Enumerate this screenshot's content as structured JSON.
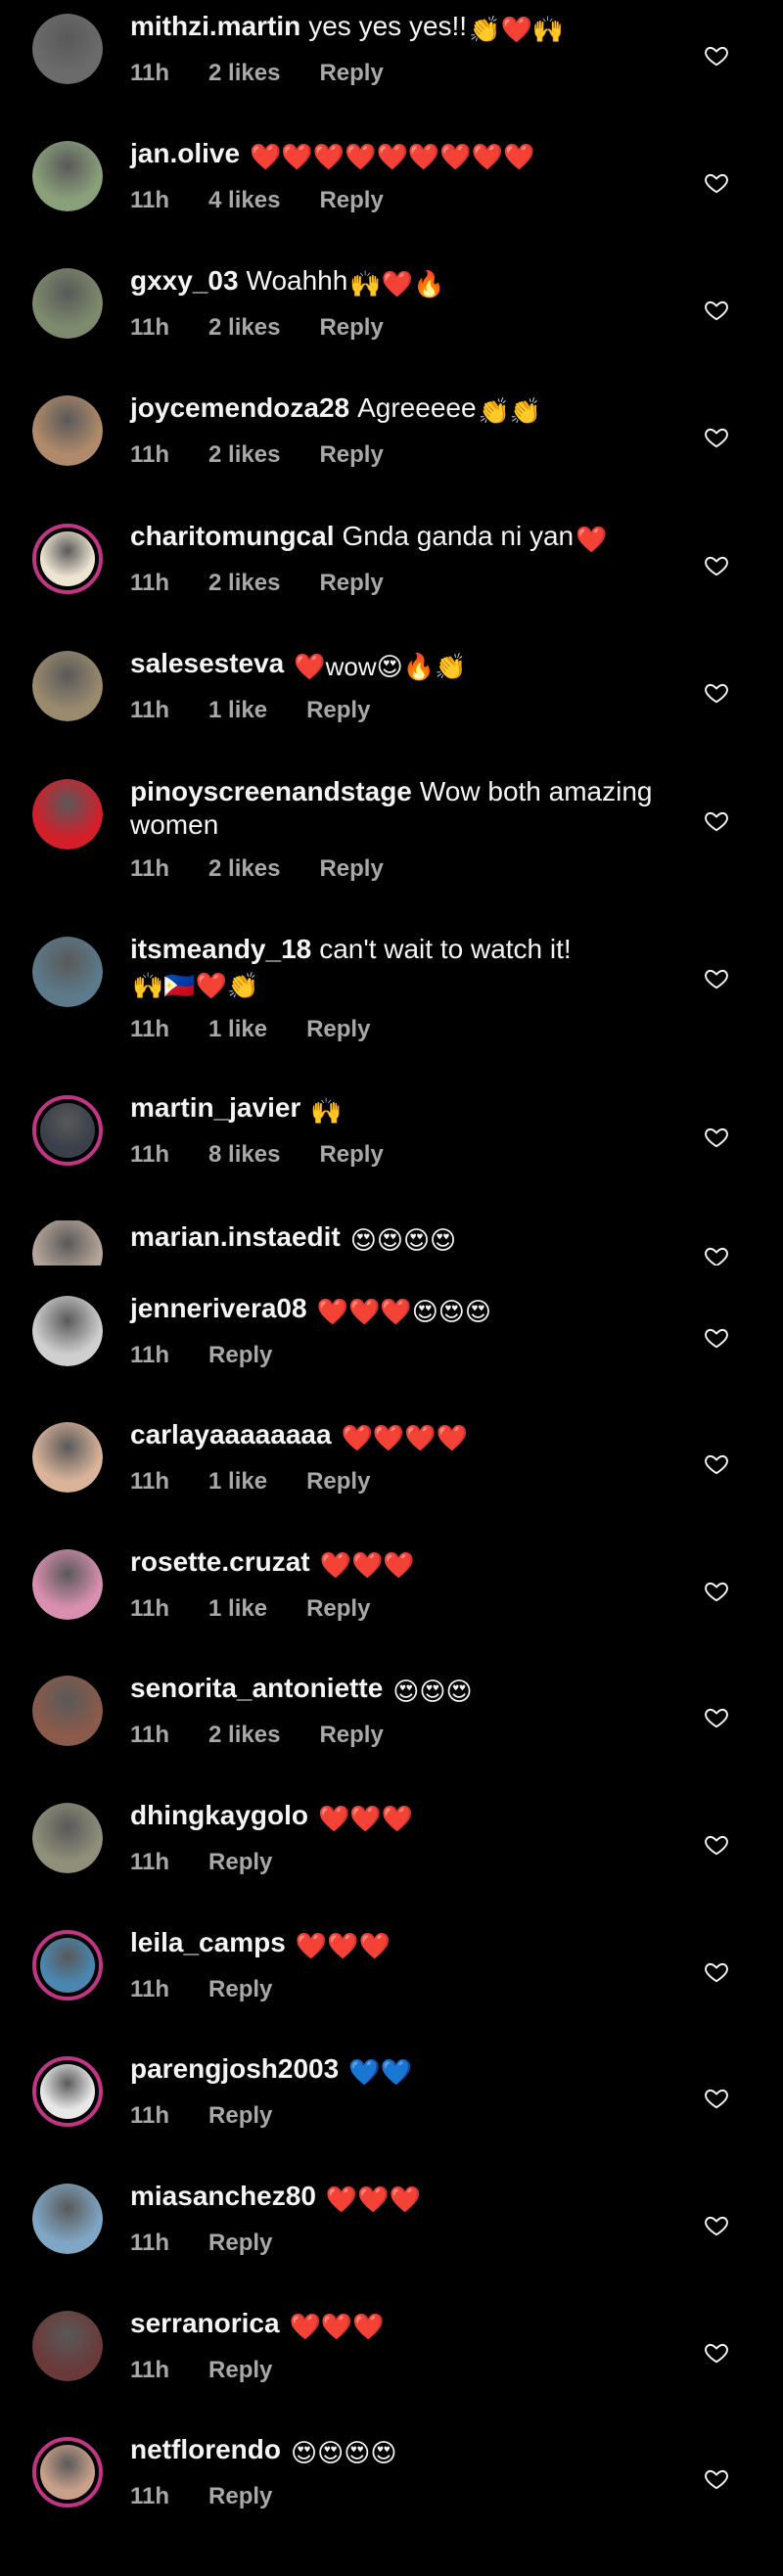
{
  "icons": {
    "like": "heart-outline-icon"
  },
  "comments": [
    {
      "user": "mithzi.martin",
      "text": "yes yes yes!!",
      "emoji": "👏❤️🙌",
      "time": "11h",
      "likes": "2 likes",
      "reply": "Reply",
      "ring": false,
      "color": "#6b6b6b"
    },
    {
      "user": "jan.olive",
      "text": "",
      "emoji": "❤️❤️❤️❤️❤️❤️❤️❤️❤️",
      "time": "11h",
      "likes": "4 likes",
      "reply": "Reply",
      "ring": false,
      "color": "#8aa07a"
    },
    {
      "user": "gxxy_03",
      "text": "Woahhh",
      "emoji": "🙌❤️🔥",
      "time": "11h",
      "likes": "2 likes",
      "reply": "Reply",
      "ring": false,
      "color": "#7d8a6c"
    },
    {
      "user": "joycemendoza28",
      "text": "Agreeeee",
      "emoji": "👏👏",
      "time": "11h",
      "likes": "2 likes",
      "reply": "Reply",
      "ring": false,
      "color": "#b08a6a"
    },
    {
      "user": "charitomungcal",
      "text": "Gnda ganda ni yan",
      "emoji": "❤️",
      "time": "11h",
      "likes": "2 likes",
      "reply": "Reply",
      "ring": true,
      "color": "#ede4d2"
    },
    {
      "user": "salesesteva",
      "text": "",
      "emoji": "❤️wow😍🔥👏",
      "time": "11h",
      "likes": "1 like",
      "reply": "Reply",
      "ring": false,
      "color": "#9a8a6e"
    },
    {
      "user": "pinoyscreenandstage",
      "text": "Wow both amazing women",
      "emoji": "",
      "time": "11h",
      "likes": "2 likes",
      "reply": "Reply",
      "ring": false,
      "color": "#d21f2a"
    },
    {
      "user": "itsmeandy_18",
      "text": "can't wait to watch it!",
      "emoji": "🙌🇵🇭❤️👏",
      "time": "11h",
      "likes": "1 like",
      "reply": "Reply",
      "ring": false,
      "color": "#5c7a8a"
    },
    {
      "user": "martin_javier",
      "text": "",
      "emoji": "🙌",
      "time": "11h",
      "likes": "8 likes",
      "reply": "Reply",
      "ring": true,
      "color": "#3a3f4a"
    },
    {
      "user": "marian.instaedit",
      "text": "",
      "emoji": "😍😍😍😍",
      "time": "",
      "likes": "",
      "reply": "",
      "ring": false,
      "color": "#b7a69a"
    },
    {
      "user": "jennerivera08",
      "text": "",
      "emoji": "❤️❤️❤️😍😍😍",
      "time": "11h",
      "likes": "",
      "reply": "Reply",
      "ring": false,
      "color": "#cfcfcf"
    },
    {
      "user": "carlayaaaaaaaa",
      "text": "",
      "emoji": "❤️❤️❤️❤️",
      "time": "11h",
      "likes": "1 like",
      "reply": "Reply",
      "ring": false,
      "color": "#d9b39a"
    },
    {
      "user": "rosette.cruzat",
      "text": "",
      "emoji": "❤️❤️❤️",
      "time": "11h",
      "likes": "1 like",
      "reply": "Reply",
      "ring": false,
      "color": "#d990b0"
    },
    {
      "user": "senorita_antoniette",
      "text": "",
      "emoji": "😍😍😍",
      "time": "11h",
      "likes": "2 likes",
      "reply": "Reply",
      "ring": false,
      "color": "#8a5a4a"
    },
    {
      "user": "dhingkaygolo",
      "text": "",
      "emoji": "❤️❤️❤️",
      "time": "11h",
      "likes": "",
      "reply": "Reply",
      "ring": false,
      "color": "#8f8f7a"
    },
    {
      "user": "leila_camps",
      "text": "",
      "emoji": "❤️❤️❤️",
      "time": "11h",
      "likes": "",
      "reply": "Reply",
      "ring": true,
      "color": "#4a86b0"
    },
    {
      "user": "parengjosh2003",
      "text": "",
      "emoji": "💙💙",
      "time": "11h",
      "likes": "",
      "reply": "Reply",
      "ring": true,
      "color": "#e8e8e8"
    },
    {
      "user": "miasanchez80",
      "text": "",
      "emoji": "❤️❤️❤️",
      "time": "11h",
      "likes": "",
      "reply": "Reply",
      "ring": false,
      "color": "#7fa6c4"
    },
    {
      "user": "serranorica",
      "text": "",
      "emoji": "❤️❤️❤️",
      "time": "11h",
      "likes": "",
      "reply": "Reply",
      "ring": false,
      "color": "#6a3a3a"
    },
    {
      "user": "netflorendo",
      "text": "",
      "emoji": "😍😍😍😍",
      "time": "11h",
      "likes": "",
      "reply": "Reply",
      "ring": true,
      "color": "#c9a08a"
    }
  ]
}
